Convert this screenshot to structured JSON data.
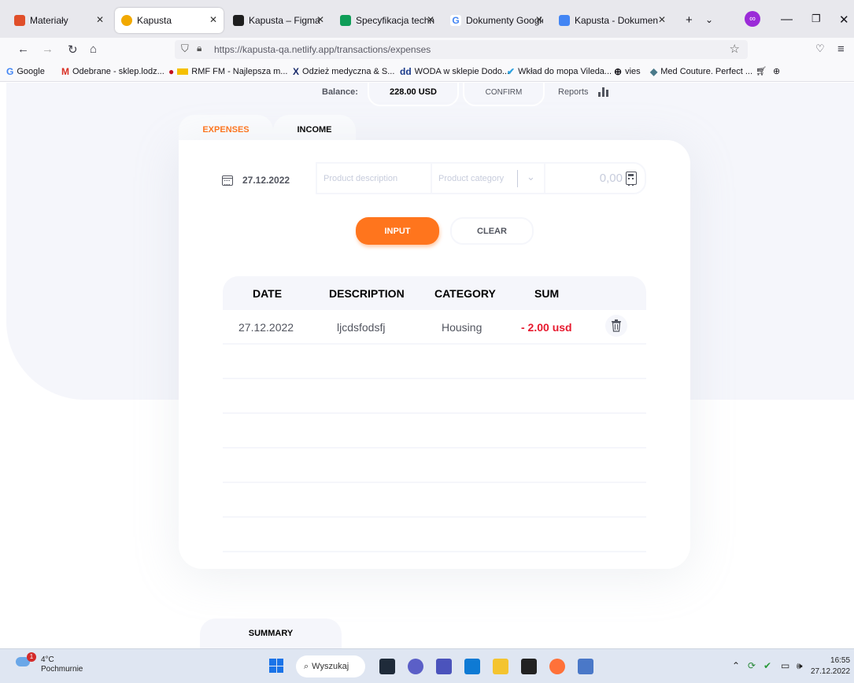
{
  "browser": {
    "tabs": [
      {
        "title": "Materiały",
        "color": "#e04f2a"
      },
      {
        "title": "Kapusta",
        "color": "#f2a900"
      },
      {
        "title": "Kapusta – Figma",
        "color": "#1e1e1e"
      },
      {
        "title": "Specyfikacja technic",
        "color": "#0f9d58"
      },
      {
        "title": "Dokumenty Google",
        "color": "#4285f4"
      },
      {
        "title": "Kapusta - Dokumen",
        "color": "#4285f4"
      }
    ],
    "url_host": "https://kapusta-qa.netlify.app",
    "url_path": "/transactions/expenses",
    "bookmarks": [
      {
        "label": "Google",
        "icon": "G"
      },
      {
        "label": "Odebrane - sklep.lodz...",
        "icon": "M"
      },
      {
        "label": "RMF FM - Najlepsza m...",
        "icon": "●"
      },
      {
        "label": "Odzież medyczna & S...",
        "icon": "X"
      },
      {
        "label": "WODA w sklepie Dodo...",
        "icon": "dd"
      },
      {
        "label": "Wkład do mopa Vileda...",
        "icon": "✔"
      },
      {
        "label": "vies",
        "icon": "⊕"
      },
      {
        "label": "Med Couture. Perfect ...",
        "icon": "◆"
      }
    ]
  },
  "header": {
    "balance_label": "Balance:",
    "balance_value": "228.00 USD",
    "confirm_label": "CONFIRM",
    "reports_label": "Reports"
  },
  "tabs": {
    "expenses": "EXPENSES",
    "income": "INCOME"
  },
  "form": {
    "date": "27.12.2022",
    "description_placeholder": "Product description",
    "category_placeholder": "Product category",
    "sum_placeholder": "0,00",
    "input_label": "INPUT",
    "clear_label": "CLEAR"
  },
  "table": {
    "headers": [
      "DATE",
      "DESCRIPTION",
      "CATEGORY",
      "SUM"
    ],
    "rows": [
      {
        "date": "27.12.2022",
        "description": "ljcdsfodsfj",
        "category": "Housing",
        "sum": "- 2.00 usd"
      }
    ]
  },
  "summary_label": "SUMMARY",
  "taskbar": {
    "temperature": "4°C",
    "condition": "Pochmurnie",
    "weather_badge": "1",
    "search_label": "Wyszukaj",
    "time": "16:55",
    "date": "27.12.2022"
  },
  "colors": {
    "accent": "#ff751d",
    "expense_red": "#e7192e",
    "background": "#f5f6fb"
  }
}
